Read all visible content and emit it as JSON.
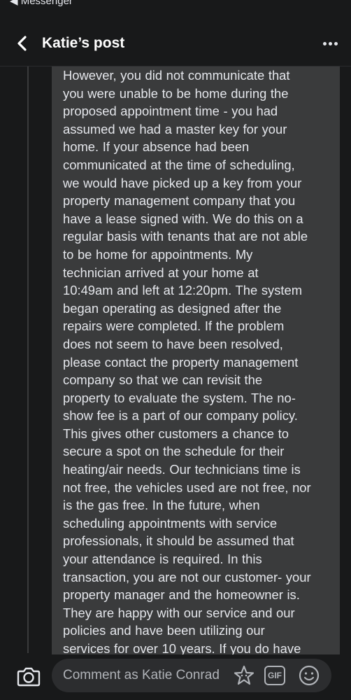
{
  "status_bar": {
    "back_app_label": "◀ Messenger"
  },
  "header": {
    "title": "Katie’s post",
    "back_icon": "chevron-left-icon",
    "more_icon": "more-horizontal-icon"
  },
  "comment": {
    "lines": [
      "However, you did not communicate that",
      "you were unable to be home during the",
      "proposed appointment time - you had",
      "assumed we had a master key for your",
      "home. If your absence had been",
      "communicated at the time of scheduling,",
      "we would have picked up a key from your",
      "property management company that you",
      "have a lease signed with. We do this on a",
      "regular basis with tenants that are not able",
      "to be home for appointments. My",
      "technician arrived at  your home at",
      "10:49am and left at 12:20pm. The system",
      "began operating as designed after the",
      "repairs were completed. If the problem",
      "does not seem to have been resolved,",
      "please contact the property management",
      "company so that we can revisit the",
      "property to evaluate the system. The no-",
      "show fee is a part of our company policy.",
      "This gives other customers a chance to",
      "secure a spot on the schedule for their",
      "heating/air needs. Our technicians time is",
      "not free, the vehicles used are not free, nor",
      "is the gas free. In the future, when",
      "scheduling appointments with service",
      "professionals, it should be assumed that",
      "your attendance is required. In this",
      "transaction, you are not our customer- your",
      "property manager and the homeowner is.",
      "They are happy with our service and our",
      "policies and have been utilizing our",
      "services for over 10 years. If you do have"
    ]
  },
  "composer": {
    "placeholder": "Comment as Katie Conrad",
    "gif_label": "GIF",
    "camera_icon": "camera-icon",
    "avatar_icon": "avatar-sticker-icon",
    "emoji_icon": "emoji-icon"
  },
  "colors": {
    "background": "#18191a",
    "bubble": "#3a3b3c",
    "text": "#e4e6eb",
    "muted": "#b0b3b8"
  }
}
